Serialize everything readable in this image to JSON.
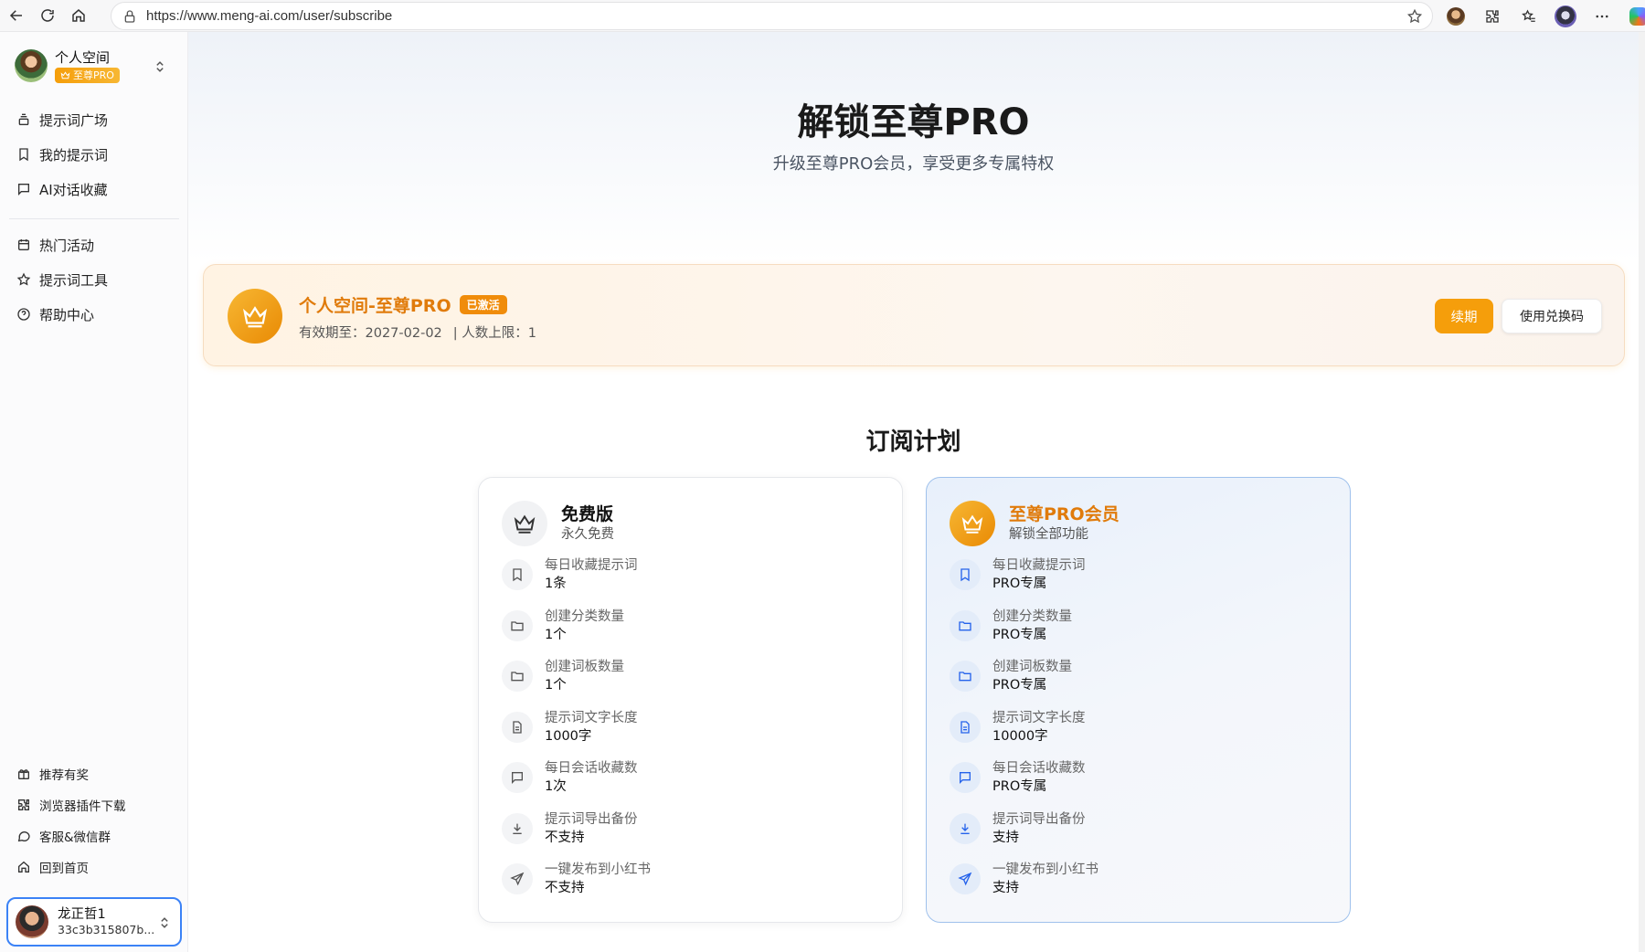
{
  "browser": {
    "url": "https://www.meng-ai.com/user/subscribe"
  },
  "sidebar": {
    "workspace": {
      "name": "个人空间",
      "badge": "至尊PRO"
    },
    "menu_top": [
      {
        "label": "提示词广场",
        "icon": "layers-icon"
      },
      {
        "label": "我的提示词",
        "icon": "bookmark-icon"
      },
      {
        "label": "AI对话收藏",
        "icon": "chat-icon"
      }
    ],
    "menu_mid": [
      {
        "label": "热门活动",
        "icon": "calendar-icon"
      },
      {
        "label": "提示词工具",
        "icon": "star-icon"
      },
      {
        "label": "帮助中心",
        "icon": "help-icon"
      }
    ],
    "menu_bottom": [
      {
        "label": "推荐有奖",
        "icon": "gift-icon"
      },
      {
        "label": "浏览器插件下载",
        "icon": "puzzle-icon"
      },
      {
        "label": "客服&微信群",
        "icon": "message-icon"
      },
      {
        "label": "回到首页",
        "icon": "home-icon"
      }
    ],
    "user": {
      "name": "龙正哲1",
      "id": "33c3b315807b..."
    }
  },
  "hero": {
    "title": "解锁至尊PRO",
    "subtitle": "升级至尊PRO会员，享受更多专属特权"
  },
  "status": {
    "title": "个人空间-至尊PRO",
    "badge": "已激活",
    "expiry": "有效期至：2027-02-02",
    "limit": "| 人数上限：1",
    "renew_label": "续期",
    "redeem_label": "使用兑换码"
  },
  "plans": {
    "title": "订阅计划",
    "free": {
      "name": "免费版",
      "sub": "永久免费",
      "features": [
        {
          "label": "每日收藏提示词",
          "value": "1条",
          "icon": "bookmark-icon"
        },
        {
          "label": "创建分类数量",
          "value": "1个",
          "icon": "folder-icon"
        },
        {
          "label": "创建词板数量",
          "value": "1个",
          "icon": "folder-icon"
        },
        {
          "label": "提示词文字长度",
          "value": "1000字",
          "icon": "document-icon"
        },
        {
          "label": "每日会话收藏数",
          "value": "1次",
          "icon": "chat-icon"
        },
        {
          "label": "提示词导出备份",
          "value": "不支持",
          "icon": "download-icon"
        },
        {
          "label": "一键发布到小红书",
          "value": "不支持",
          "icon": "send-icon"
        }
      ]
    },
    "pro": {
      "name": "至尊PRO会员",
      "sub": "解锁全部功能",
      "features": [
        {
          "label": "每日收藏提示词",
          "value": "PRO专属",
          "icon": "bookmark-icon"
        },
        {
          "label": "创建分类数量",
          "value": "PRO专属",
          "icon": "folder-icon"
        },
        {
          "label": "创建词板数量",
          "value": "PRO专属",
          "icon": "folder-icon"
        },
        {
          "label": "提示词文字长度",
          "value": "10000字",
          "icon": "document-icon"
        },
        {
          "label": "每日会话收藏数",
          "value": "PRO专属",
          "icon": "chat-icon"
        },
        {
          "label": "提示词导出备份",
          "value": "支持",
          "icon": "download-icon"
        },
        {
          "label": "一键发布到小红书",
          "value": "支持",
          "icon": "send-icon"
        }
      ]
    }
  },
  "colors": {
    "accent": "#f59e0b",
    "pro_text": "#e07b0b",
    "pro_border": "#9fc1ec",
    "active_border": "#3b82f6"
  }
}
